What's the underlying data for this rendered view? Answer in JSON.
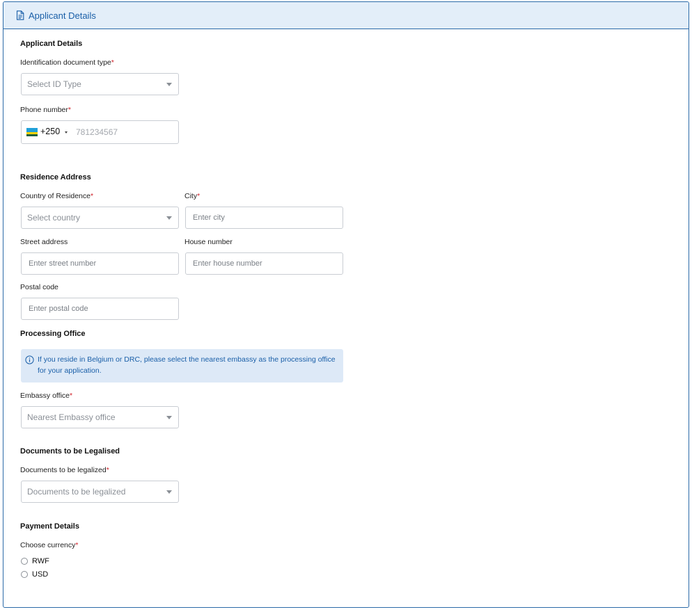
{
  "header": {
    "title": "Applicant Details",
    "icon": "document-icon"
  },
  "applicant": {
    "section_title": "Applicant Details",
    "id_type": {
      "label": "Identification document type",
      "required": "*",
      "placeholder": "Select ID Type"
    },
    "phone": {
      "label": "Phone number",
      "required": "*",
      "dial_code": "+250",
      "placeholder": "781234567"
    }
  },
  "residence": {
    "section_title": "Residence Address",
    "country": {
      "label": "Country of Residence",
      "required": "*",
      "placeholder": "Select country"
    },
    "city": {
      "label": "City",
      "required": "*",
      "placeholder": "Enter city"
    },
    "street": {
      "label": "Street address",
      "placeholder": "Enter street number"
    },
    "house": {
      "label": "House number",
      "placeholder": "Enter house number"
    },
    "postal": {
      "label": "Postal code",
      "placeholder": "Enter postal code"
    }
  },
  "processing": {
    "section_title": "Processing Office",
    "notice": "If you reside in Belgium or DRC, please select the nearest embassy as the processing office for your application.",
    "embassy": {
      "label": "Embassy office",
      "required": "*",
      "placeholder": "Nearest Embassy office"
    }
  },
  "documents": {
    "section_title": "Documents to be Legalised",
    "docs": {
      "label": "Documents to be legalized",
      "required": "*",
      "placeholder": "Documents to be legalized"
    }
  },
  "payment": {
    "section_title": "Payment Details",
    "currency": {
      "label": "Choose currency",
      "required": "*",
      "options": [
        "RWF",
        "USD"
      ]
    }
  },
  "colors": {
    "accent": "#1a5fa8",
    "header_bg": "#e3eef9",
    "required": "#d0222a",
    "notice_bg": "#dde9f7"
  }
}
